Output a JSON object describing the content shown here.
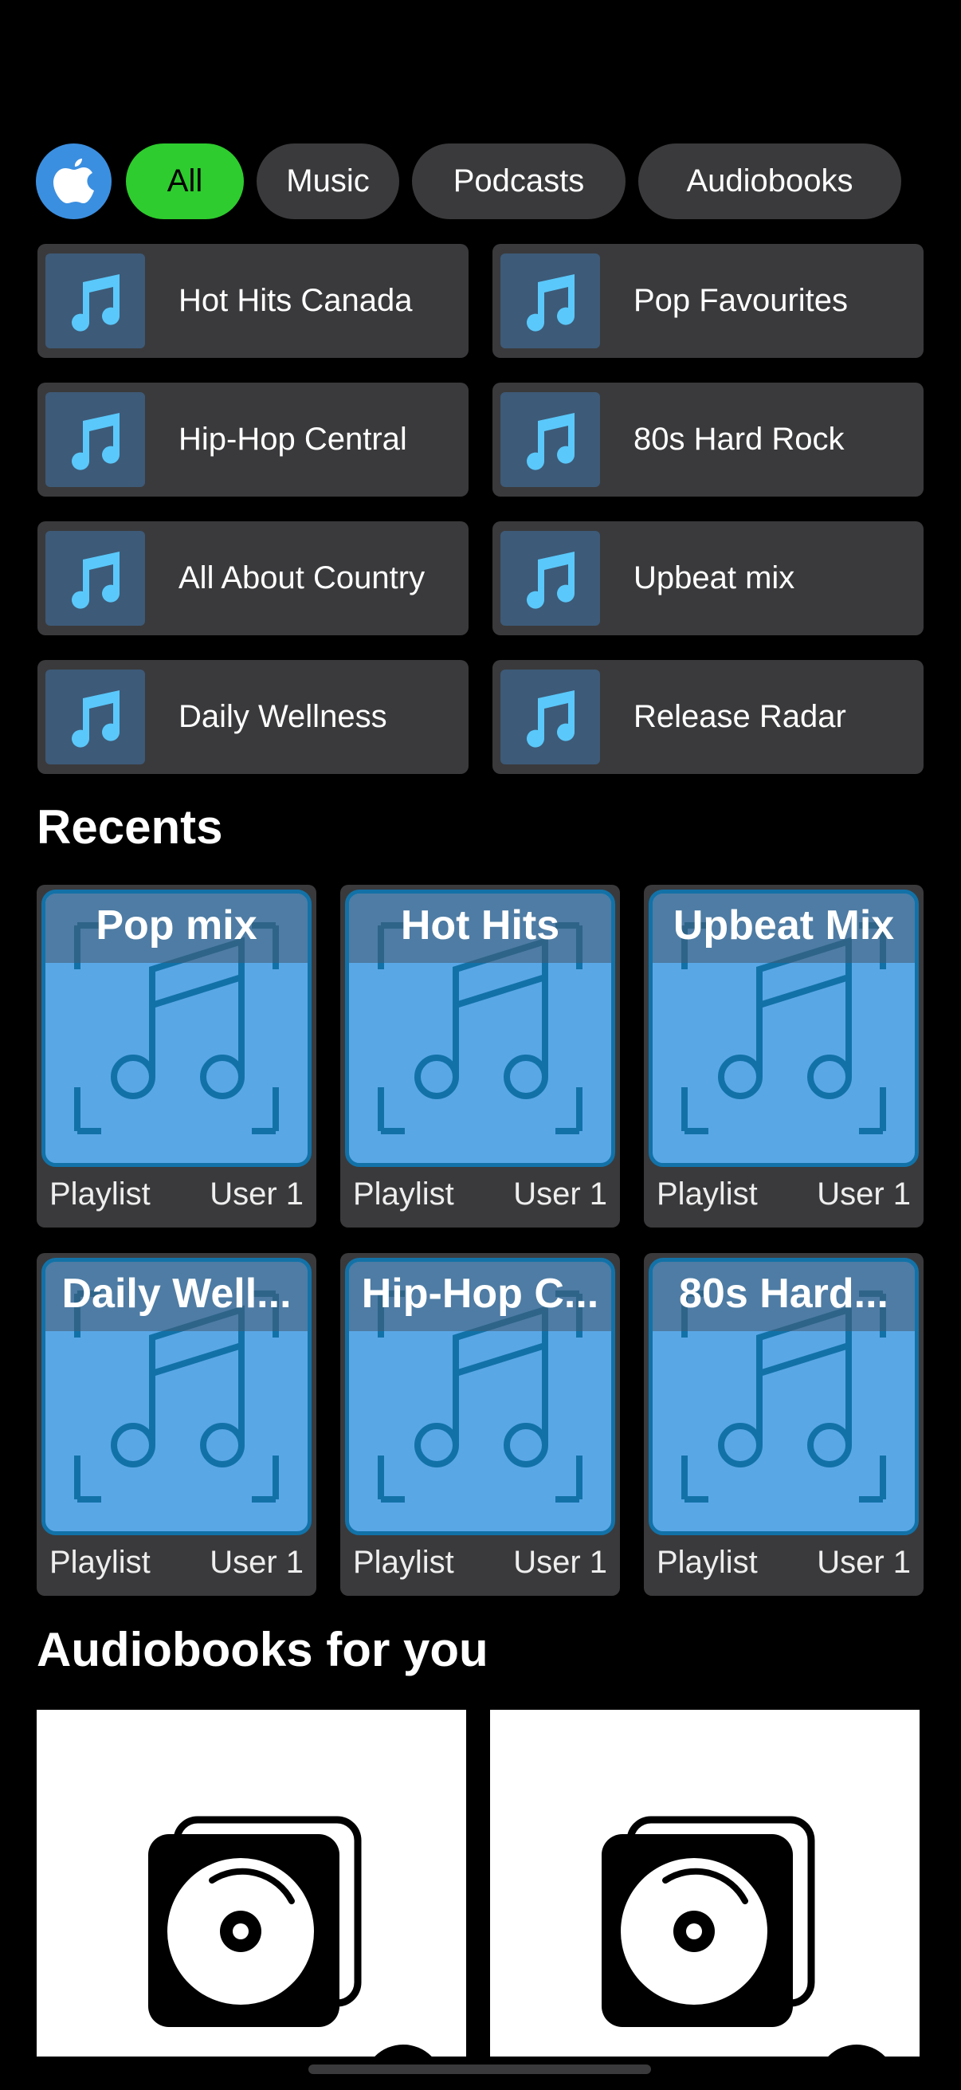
{
  "filters": {
    "avatar_icon": "apple-logo-icon",
    "chips": [
      {
        "label": "All",
        "active": true
      },
      {
        "label": "Music",
        "active": false
      },
      {
        "label": "Podcasts",
        "active": false
      },
      {
        "label": "Audiobooks",
        "active": false
      }
    ]
  },
  "quick_access": [
    {
      "label": "Hot Hits Canada"
    },
    {
      "label": "Pop Favourites"
    },
    {
      "label": "Hip-Hop Central"
    },
    {
      "label": "80s Hard Rock"
    },
    {
      "label": "All About Country"
    },
    {
      "label": "Upbeat mix"
    },
    {
      "label": "Daily Wellness"
    },
    {
      "label": "Release Radar"
    }
  ],
  "recents": {
    "title": "Recents",
    "items": [
      {
        "title": "Pop mix",
        "type": "Playlist",
        "owner": "User 1"
      },
      {
        "title": "Hot Hits",
        "type": "Playlist",
        "owner": "User 1"
      },
      {
        "title": "Upbeat Mix",
        "type": "Playlist",
        "owner": "User 1"
      },
      {
        "title": "Daily Well...",
        "type": "Playlist",
        "owner": "User 1"
      },
      {
        "title": "Hip-Hop C...",
        "type": "Playlist",
        "owner": "User 1"
      },
      {
        "title": "80s Hard...",
        "type": "Playlist",
        "owner": "User 1"
      }
    ]
  },
  "audiobooks": {
    "title": "Audiobooks for you",
    "items": [
      {
        "icon": "audiobook-disc-icon"
      },
      {
        "icon": "audiobook-disc-icon"
      }
    ]
  },
  "colors": {
    "background": "#000000",
    "active_chip": "#2ecc2e",
    "card": "#3a3a3c",
    "art_blue": "#5aa7e6",
    "note_icon": "#5ac8fa"
  }
}
